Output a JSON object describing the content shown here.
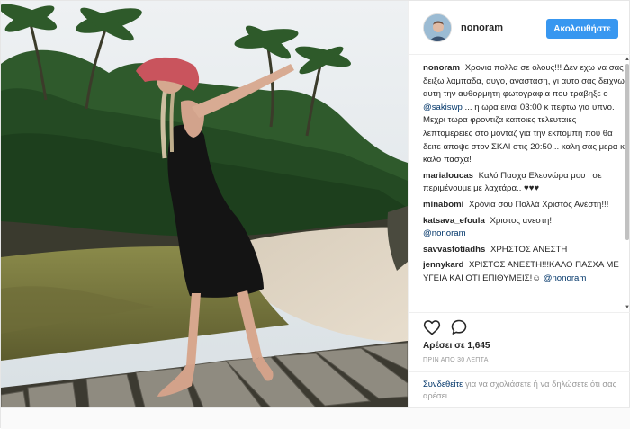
{
  "post": {
    "username": "nonoram",
    "follow_label": "Ακολουθήστε",
    "caption": {
      "user": "nonoram",
      "text_before": "Χρονια πολλα σε ολους!!! Δεν εχω να σας δειξω λαμπαδα, αυγο, ανασταση, γι αυτο σας δειχνω αυτη την αυθορμητη φωτογραφια που τραβηξε ο",
      "mention": "@sakiswp",
      "text_after": "... η ωρα ειναι 03:00 κ πεφτω για υπνο. Μεχρι τωρα φροντιζα καποιες τελευταιες λεπτομερειες στο μονταζ για την εκπομπη που θα δειτε αποψε στον ΣΚΑΙ στις 20:50... καλη σας μερα κ καλο πασχα!"
    },
    "comments": [
      {
        "user": "marialoucas",
        "text": "Καλό Πασχα Ελεονώρα μου , σε περιμένουμε με λαχτάρα.. ♥♥♥"
      },
      {
        "user": "minabomi",
        "text": "Χρόνια σου Πολλά Χριστός Ανέστη!!!"
      },
      {
        "user": "katsava_efoula",
        "text": "Χριστος ανεστη!",
        "mention": "@nonoram"
      },
      {
        "user": "savvasfotiadhs",
        "text": "ΧΡΗΣΤΟΣ ΑΝΕΣΤΗ"
      },
      {
        "user": "jennykard",
        "text": "ΧΡΙΣΤΟΣ ΑΝΕΣΤΗ!!!ΚΑΛΟ ΠΑΣΧΑ ΜΕ ΥΓΕΙΑ ΚΑΙ ΟΤΙ ΕΠΙΘΥΜΕΙΣ!☺",
        "mention": "@nonoram"
      }
    ],
    "likes_label": "Αρέσει σε 1,645",
    "timestamp": "ΠΡΙΝ ΑΠΟ 30 ΛΕΠΤΑ",
    "login_prompt": {
      "link": "Συνδεθείτε",
      "text": "για να σχολιάσετε ή να δηλώσετε ότι σας αρέσει."
    }
  },
  "icons": {
    "like": "heart-icon",
    "comment": "speech-bubble-icon",
    "scroll_up": "triangle-up-icon",
    "scroll_down": "triangle-down-icon"
  },
  "colors": {
    "follow_button": "#3897f0",
    "link": "#003569",
    "text": "#262626",
    "muted": "#999999"
  }
}
